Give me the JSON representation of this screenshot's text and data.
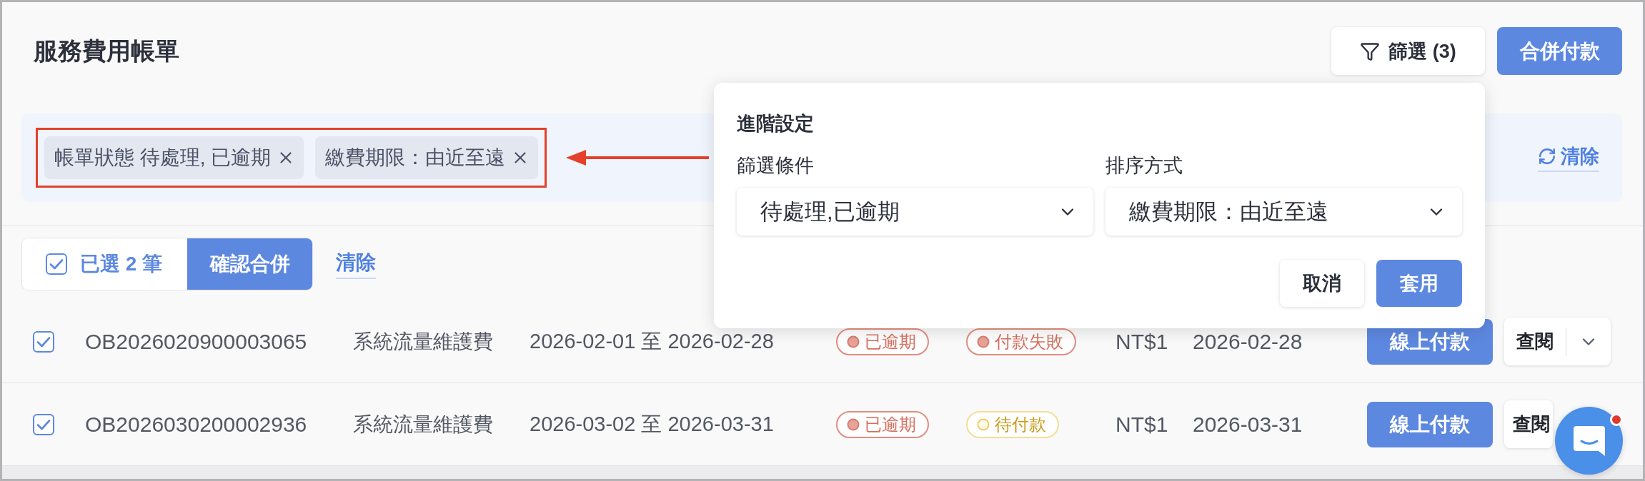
{
  "page": {
    "title": "服務費用帳單"
  },
  "toolbar": {
    "filter_button": "篩選 (3)",
    "merge_button": "合併付款"
  },
  "active_filters": {
    "highlighted": true,
    "chips": [
      {
        "label": "帳單狀態 待處理, 已逾期"
      },
      {
        "label": "繳費期限：由近至遠"
      }
    ],
    "clear_link": "清除"
  },
  "selection_bar": {
    "checked": true,
    "summary": "已選 2 筆",
    "confirm_button": "確認合併",
    "clear_link": "清除"
  },
  "rows": [
    {
      "checked": true,
      "id": "OB2026020900003065",
      "item": "系統流量維護費",
      "period": "2026-02-01 至 2026-02-28",
      "bill_status": {
        "label": "已逾期",
        "kind": "overdue"
      },
      "payment_status": {
        "label": "付款失敗",
        "kind": "failed"
      },
      "amount": "NT$1",
      "due_date": "2026-02-28",
      "pay_button": "線上付款",
      "view_button": "查閱",
      "more_menu": true
    },
    {
      "checked": true,
      "id": "OB2026030200002936",
      "item": "系統流量維護費",
      "period": "2026-03-02 至 2026-03-31",
      "bill_status": {
        "label": "已逾期",
        "kind": "overdue"
      },
      "payment_status": {
        "label": "待付款",
        "kind": "pending"
      },
      "amount": "NT$1",
      "due_date": "2026-03-31",
      "pay_button": "線上付款",
      "view_button": "查閱",
      "more_menu": false
    }
  ],
  "popover": {
    "title": "進階設定",
    "fields": [
      {
        "label": "篩選條件",
        "value": "待處理,已逾期"
      },
      {
        "label": "排序方式",
        "value": "繳費期限：由近至遠"
      }
    ],
    "buttons": [
      {
        "label": "取消",
        "kind": "secondary"
      },
      {
        "label": "套用",
        "kind": "primary"
      }
    ]
  },
  "chat_button": {
    "unread": true
  }
}
